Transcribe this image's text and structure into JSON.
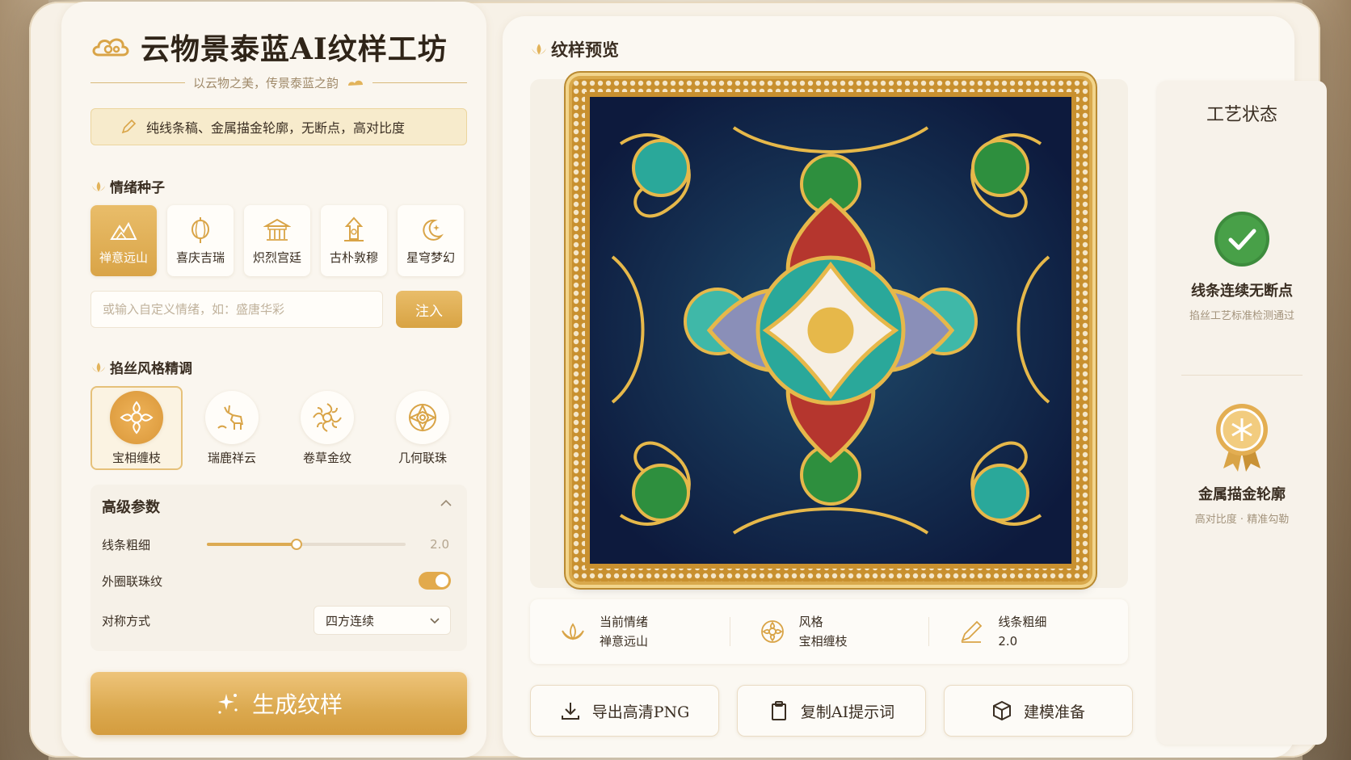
{
  "app": {
    "title": "云物景泰蓝AI纹样工坊",
    "subtitle": "以云物之美，传景泰蓝之韵",
    "hint": "纯线条稿、金属描金轮廓，无断点，高对比度"
  },
  "emotion": {
    "title": "情绪种子",
    "items": [
      {
        "label": "禅意远山",
        "icon": "mountain-icon",
        "active": true
      },
      {
        "label": "喜庆吉瑞",
        "icon": "lantern-icon",
        "active": false
      },
      {
        "label": "炽烈宫廷",
        "icon": "palace-icon",
        "active": false
      },
      {
        "label": "古朴敦穆",
        "icon": "pagoda-icon",
        "active": false
      },
      {
        "label": "星穹梦幻",
        "icon": "moon-star-icon",
        "active": false
      }
    ],
    "custom_placeholder": "或输入自定义情绪，如：盛唐华彩",
    "inject_label": "注入"
  },
  "style": {
    "title": "掐丝风格精调",
    "items": [
      {
        "label": "宝相缠枝",
        "active": true
      },
      {
        "label": "瑞鹿祥云",
        "active": false
      },
      {
        "label": "卷草金纹",
        "active": false
      },
      {
        "label": "几何联珠",
        "active": false
      }
    ]
  },
  "advanced": {
    "title": "高级参数",
    "line_label": "线条粗细",
    "line_value": "2.0",
    "line_fraction": 0.45,
    "ring_label": "外圈联珠纹",
    "ring_on": true,
    "sym_label": "对称方式",
    "sym_value": "四方连续"
  },
  "generate_label": "生成纹样",
  "preview": {
    "title": "纹样预览",
    "info": [
      {
        "label": "当前情绪",
        "value": "禅意远山"
      },
      {
        "label": "风格",
        "value": "宝相缠枝"
      },
      {
        "label": "线条粗细",
        "value": "2.0"
      }
    ],
    "actions": [
      "导出高清PNG",
      "复制AI提示词",
      "建模准备"
    ]
  },
  "status": {
    "title": "工艺状态",
    "check_main": "线条连续无断点",
    "check_sub": "掐丝工艺标准检测通过",
    "gold_main": "金属描金轮廓",
    "gold_sub": "高对比度 · 精准勾勒"
  },
  "colors": {
    "gold": "#dba94f",
    "check_green": "#3d8c3d",
    "cream": "#f7f1e7"
  }
}
